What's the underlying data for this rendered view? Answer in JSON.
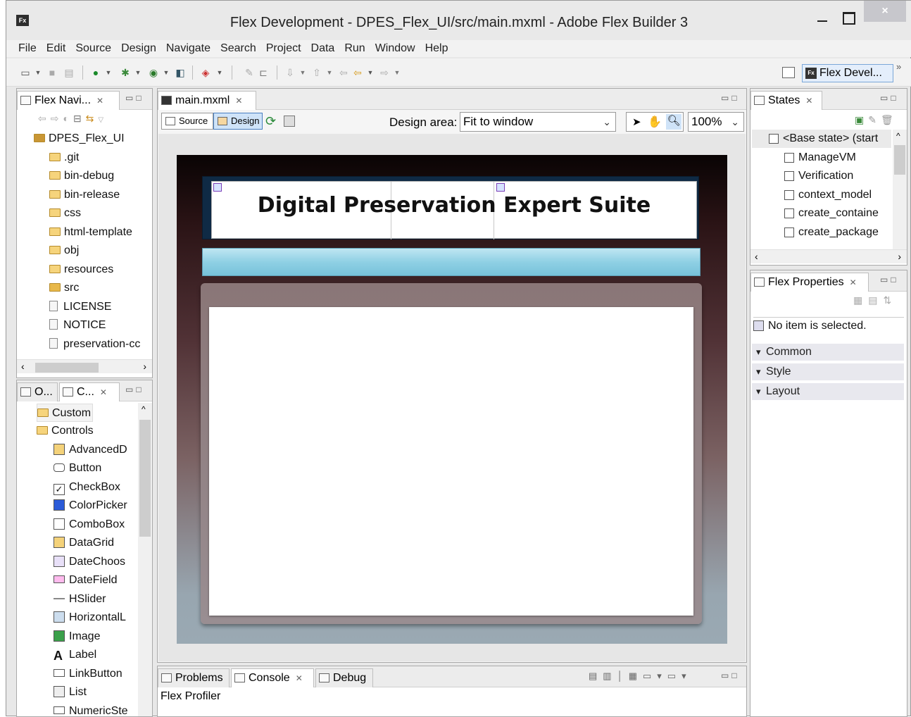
{
  "window": {
    "title": "Flex Development - DPES_Flex_UI/src/main.mxml - Adobe Flex Builder 3",
    "app_icon": "Fx",
    "close_label": "×"
  },
  "menu": [
    "File",
    "Edit",
    "Source",
    "Design",
    "Navigate",
    "Search",
    "Project",
    "Data",
    "Run",
    "Window",
    "Help"
  ],
  "perspective": {
    "label": "Flex Devel...",
    "overflow": "»"
  },
  "navigator": {
    "tab_label": "Flex Navi...",
    "project": "DPES_Flex_UI",
    "items": [
      {
        "label": ".git",
        "type": "folder"
      },
      {
        "label": "bin-debug",
        "type": "folder"
      },
      {
        "label": "bin-release",
        "type": "folder"
      },
      {
        "label": "css",
        "type": "folder"
      },
      {
        "label": "html-template",
        "type": "folder"
      },
      {
        "label": "obj",
        "type": "folder"
      },
      {
        "label": "resources",
        "type": "folder"
      },
      {
        "label": "src",
        "type": "source-folder"
      },
      {
        "label": "LICENSE",
        "type": "file"
      },
      {
        "label": "NOTICE",
        "type": "file"
      },
      {
        "label": "preservation-cc",
        "type": "file"
      }
    ]
  },
  "components": {
    "tab_outline": "O...",
    "tab_components": "C...",
    "folders": [
      "Custom",
      "Controls"
    ],
    "controls": [
      "AdvancedD",
      "Button",
      "CheckBox",
      "ColorPicker",
      "ComboBox",
      "DataGrid",
      "DateChoos",
      "DateField",
      "HSlider",
      "HorizontalL",
      "Image",
      "Label",
      "LinkButton",
      "List",
      "NumericSte"
    ]
  },
  "editor": {
    "tab_label": "main.mxml",
    "source_label": "Source",
    "design_label": "Design",
    "design_area_label": "Design area:",
    "design_area_value": "Fit to window",
    "zoom": "100%",
    "app_title": "Digital Preservation Expert Suite"
  },
  "states": {
    "tab_label": "States",
    "items": [
      "<Base state> (start",
      "ManageVM",
      "Verification",
      "context_model",
      "create_containe",
      "create_package"
    ]
  },
  "properties": {
    "tab_label": "Flex Properties",
    "message": "No item is selected.",
    "sections": [
      "Common",
      "Style",
      "Layout"
    ]
  },
  "bottom": {
    "tabs": [
      "Problems",
      "Console",
      "Debug"
    ],
    "content": "Flex Profiler"
  }
}
